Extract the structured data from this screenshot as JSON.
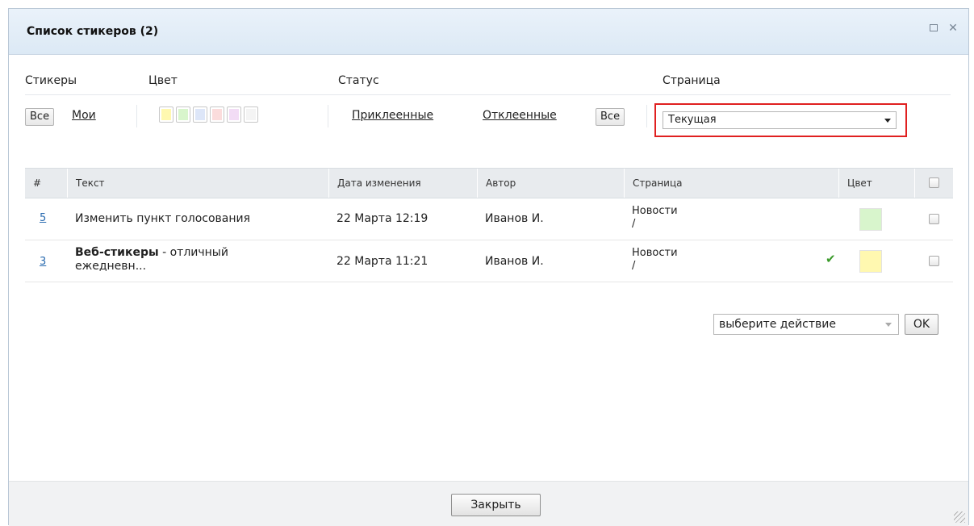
{
  "dialog": {
    "title": "Список стикеров (2)",
    "maximize_icon": "maximize-icon",
    "close_icon": "close-icon",
    "close_glyph": "✕"
  },
  "filters": {
    "labels": {
      "stickers": "Стикеры",
      "color": "Цвет",
      "status": "Статус",
      "page": "Страница"
    },
    "stickers": {
      "all": "Все",
      "mine": "Мои"
    },
    "color_swatches": [
      "#fff8b0",
      "#d8f5cc",
      "#dde6f8",
      "#fbdcdc",
      "#f2dcf5",
      "#f4f4f4"
    ],
    "status": {
      "attached": "Приклеенные",
      "detached": "Отклеенные",
      "all": "Все"
    },
    "page_select": {
      "value": "Текущая"
    }
  },
  "table": {
    "columns": [
      "#",
      "Текст",
      "Дата изменения",
      "Автор",
      "Страница",
      "Цвет"
    ],
    "rows": [
      {
        "id": "5",
        "text_bold": "",
        "text": "Изменить пункт голосования",
        "text_line2": "",
        "date": "22 Марта 12:19",
        "author": "Иванов И.",
        "page": "Новости",
        "page_path": "/",
        "check": "",
        "color": "#d8f5cc"
      },
      {
        "id": "3",
        "text_bold": "Веб-стикеры",
        "text": " - отличный",
        "text_line2": "ежедневн...",
        "date": "22 Марта 11:21",
        "author": "Иванов И.",
        "page": "Новости",
        "page_path": "/",
        "check": "✔",
        "color": "#fff8b0"
      }
    ]
  },
  "actions": {
    "select_placeholder": "выберите действие",
    "ok_label": "OK"
  },
  "footer": {
    "close_label": "Закрыть"
  }
}
